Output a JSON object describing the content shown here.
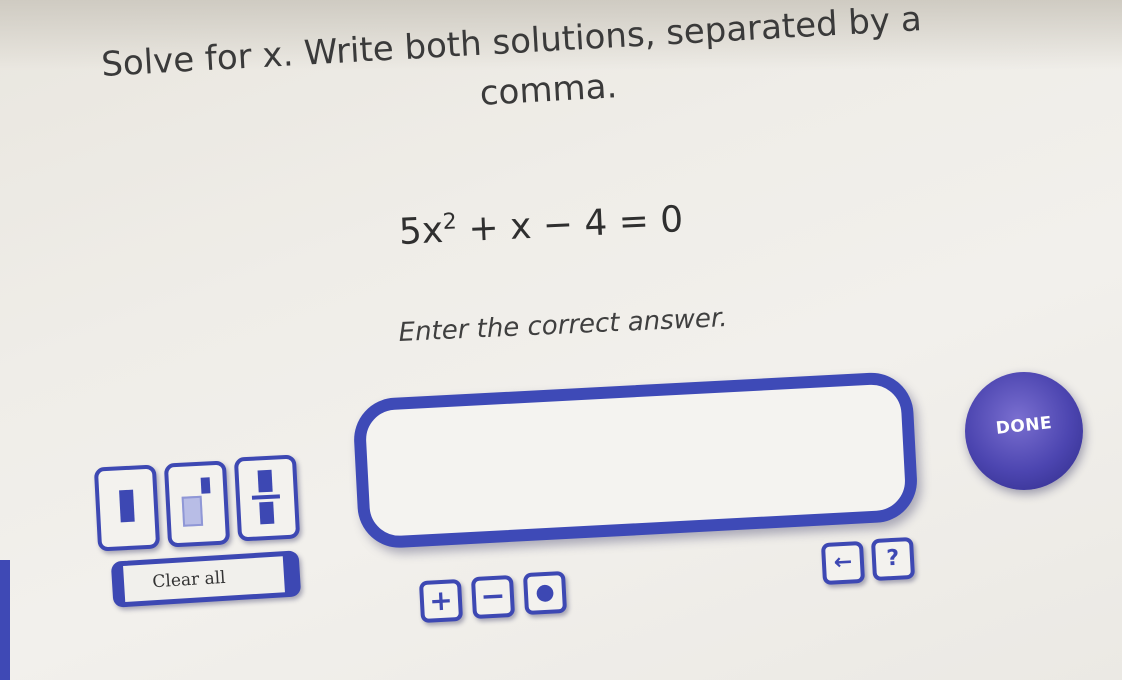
{
  "question": {
    "line1": "Solve for x. Write both solutions, separated by a",
    "line2": "comma.",
    "equation": {
      "coefficient": "5x",
      "exponent": "2",
      "rest": " + x − 4 = 0"
    },
    "instruction": "Enter the correct answer."
  },
  "answer": {
    "value": "",
    "placeholder": ""
  },
  "buttons": {
    "done": "DONE",
    "clear_all": "Clear all",
    "plus": "+",
    "minus": "−",
    "dot": "●",
    "backspace": "←",
    "help": "?"
  },
  "tools": [
    {
      "name": "blank-template"
    },
    {
      "name": "exponent-template"
    },
    {
      "name": "fraction-template"
    }
  ],
  "colors": {
    "accent": "#3d48b3",
    "done": "#4c45b0",
    "background": "#efede8"
  }
}
